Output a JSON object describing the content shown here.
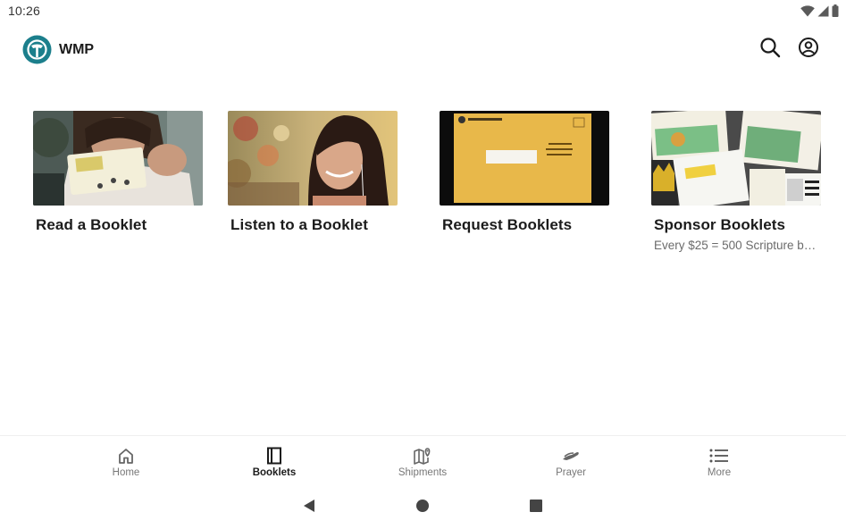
{
  "status_bar": {
    "time": "10:26",
    "icons": [
      "wifi-icon",
      "cell-signal-icon",
      "battery-icon"
    ]
  },
  "app_bar": {
    "title": "WMP",
    "logo_icon": "wmp-logo-icon",
    "actions": [
      "search-icon",
      "account-icon"
    ]
  },
  "cards": [
    {
      "title": "Read a Booklet",
      "subtitle": "",
      "image": "girl-reading-booklet-photo"
    },
    {
      "title": "Listen to a Booklet",
      "subtitle": "",
      "image": "woman-with-earbuds-photo"
    },
    {
      "title": "Request Booklets",
      "subtitle": "",
      "image": "yellow-envelope-photo"
    },
    {
      "title": "Sponsor Booklets",
      "subtitle": "Every $25 = 500 Scripture b…",
      "image": "booklet-covers-collage-photo"
    }
  ],
  "bottom_nav": {
    "items": [
      {
        "label": "Home",
        "icon": "home-icon",
        "active": false
      },
      {
        "label": "Booklets",
        "icon": "booklet-icon",
        "active": true
      },
      {
        "label": "Shipments",
        "icon": "map-pin-icon",
        "active": false
      },
      {
        "label": "Prayer",
        "icon": "praying-hands-icon",
        "active": false
      },
      {
        "label": "More",
        "icon": "list-icon",
        "active": false
      }
    ]
  },
  "colors": {
    "brand_teal": "#1c7f8c",
    "active_nav": "#1b1b1b",
    "inactive_nav": "#777777",
    "envelope_yellow": "#e8b84a"
  }
}
